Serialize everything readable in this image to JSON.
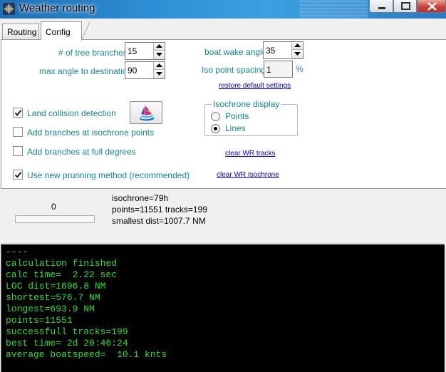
{
  "window": {
    "title": "Weather routing"
  },
  "tabs": [
    {
      "label": "Routing"
    },
    {
      "label": "Config"
    }
  ],
  "config": {
    "tree_branches": {
      "label": "# of tree branches:",
      "value": "15"
    },
    "max_angle": {
      "label": "max angle to destination:",
      "value": "90"
    },
    "boat_wake": {
      "label": "boat wake angle:",
      "value": "35"
    },
    "iso_spacing": {
      "label": "Iso point spacing:",
      "value": "1",
      "unit": "%"
    },
    "restore_link": "restore default settings",
    "checkboxes": [
      {
        "label": "Land collision detection",
        "checked": true
      },
      {
        "label": "Add branches at isochrone points",
        "checked": false
      },
      {
        "label": "Add branches at full degrees",
        "checked": false
      },
      {
        "label": "Use new prunning method (recommended)",
        "checked": true
      }
    ],
    "isochrone_display": {
      "legend": "Isochrone display",
      "options": [
        {
          "label": "Points",
          "selected": false
        },
        {
          "label": "Lines",
          "selected": true
        }
      ]
    },
    "clear_tracks_link": "clear WR tracks",
    "clear_isochrone_link": "clear WR  Isochrone"
  },
  "status": {
    "counter": "0",
    "progress": 0,
    "isochrone": "isochrone=79h",
    "points_tracks": "points=11551  tracks=199",
    "smallest_dist": "smallest dist=1007.7 NM"
  },
  "console": {
    "lines": [
      "----",
      "calculation finished",
      "calc time=  2.22 sec",
      "LGC dist=1696.8 NM",
      "shortest=576.7 NM",
      "longest=693.9 NM",
      "points=11551",
      "successfull tracks=199",
      "best time= 2d 20:46:24",
      "average boatspeed=  10.1 knts"
    ]
  },
  "colors": {
    "label_teal": "#138a8a",
    "link_blue": "#0000c8",
    "console_green": "#23e02b",
    "console_bg": "#000000"
  }
}
